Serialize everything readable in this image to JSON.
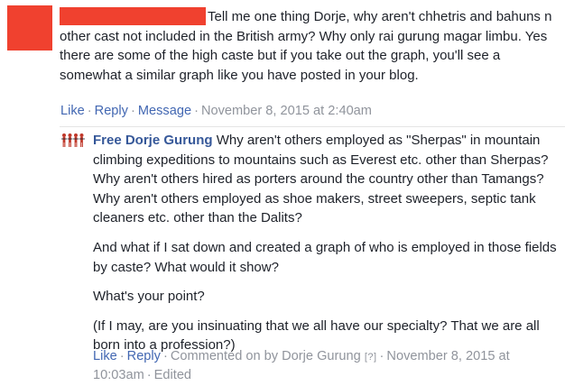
{
  "comment": {
    "author_redacted": true,
    "text": "Tell me one thing Dorje, why aren't chhetris and bahuns n other cast not included in the British army? Why only rai gurung magar limbu. Yes there are some of the high caste but if you take out the graph, you'll see a somewhat a similar graph like you have posted in your blog.",
    "actions": {
      "like": "Like",
      "reply": "Reply",
      "message": "Message",
      "timestamp": "November 8, 2015 at 2:40am"
    }
  },
  "reply": {
    "author": "Free Dorje Gurung",
    "paragraphs": [
      "Why aren't others employed as \"Sherpas\" in mountain climbing expeditions to mountains such as Everest etc. other than Sherpas? Why aren't others hired as porters around the country other than Tamangs? Why aren't others employed as shoe makers, street sweepers, septic tank cleaners etc. other than the Dalits?",
      "And what if I sat down and created a graph of who is employed in those fields by caste? What would it show?",
      "What's your point?",
      "(If I may, are you insinuating that we all have our specialty? That we are all born into a profession?)"
    ],
    "actions": {
      "like": "Like",
      "reply": "Reply",
      "commented_on_by": "Commented on by Dorje Gurung",
      "help_mark": "[?]",
      "timestamp": "November 8, 2015 at 10:03am",
      "edited": "Edited"
    }
  },
  "colors": {
    "redaction": "#f0412f",
    "link": "#4267b2",
    "author_link": "#365899",
    "meta": "#90949c",
    "text": "#1d2129"
  },
  "icons": {
    "reply_avatar": "people-figures-icon"
  }
}
